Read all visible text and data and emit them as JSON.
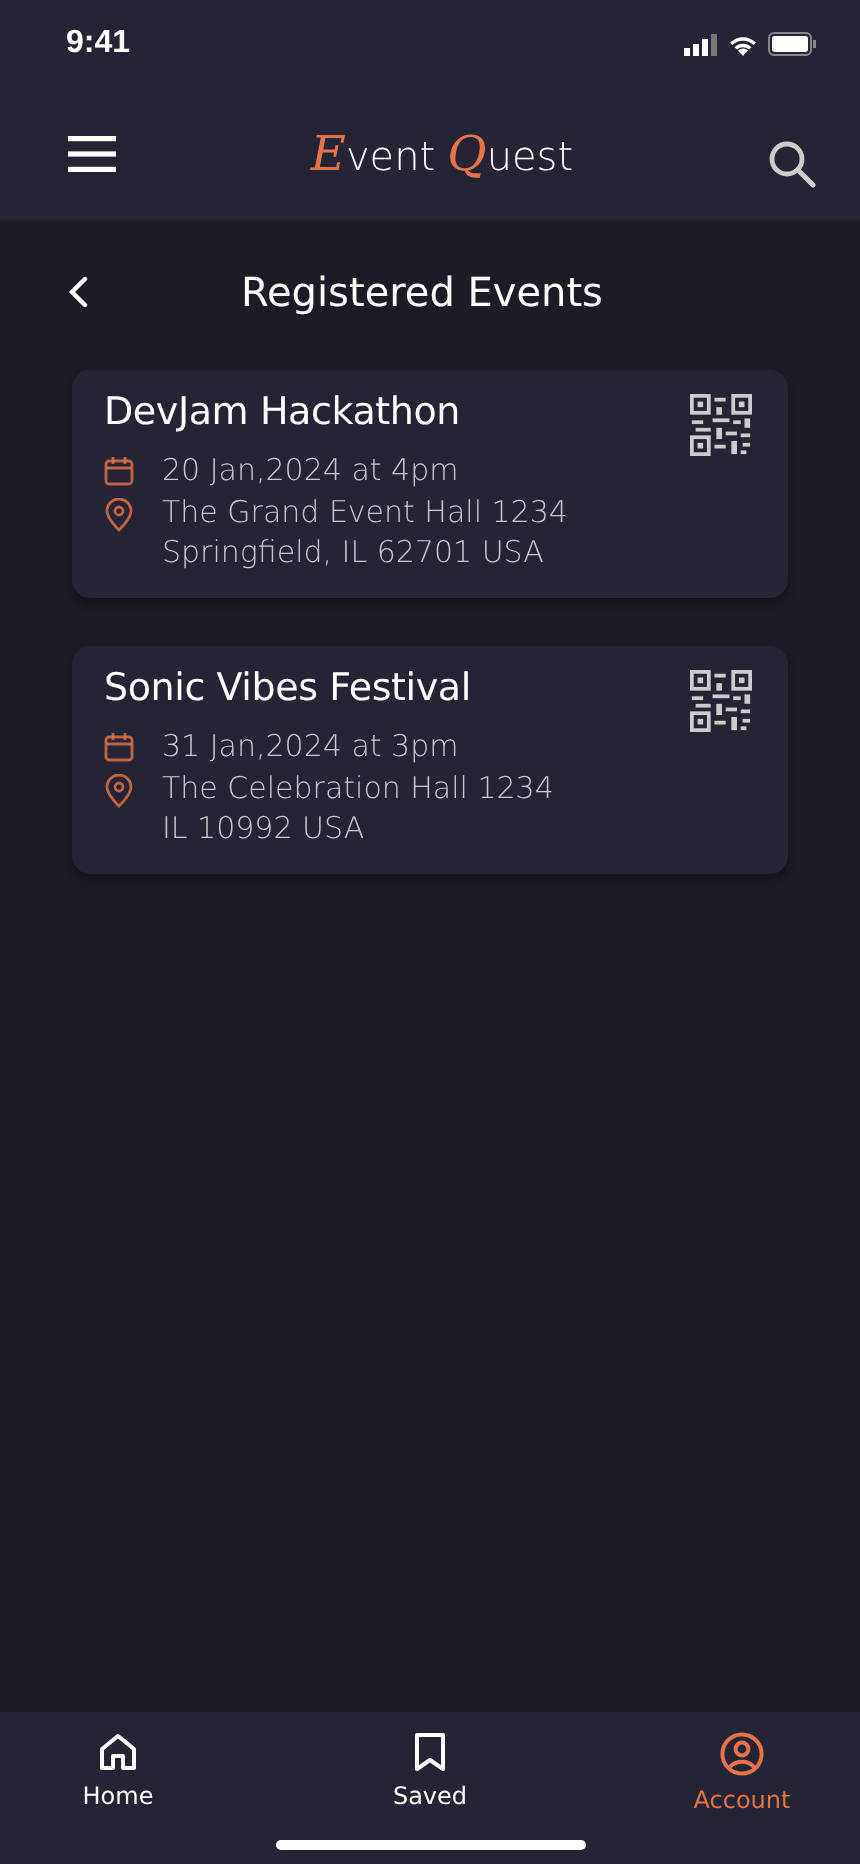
{
  "status_bar": {
    "time": "9:41"
  },
  "header": {
    "logo_words": [
      "Event",
      "Quest"
    ]
  },
  "page": {
    "title": "Registered Events"
  },
  "events": [
    {
      "name": "DevJam Hackathon",
      "date": "20 Jan,2024 at 4pm",
      "address": [
        "The Grand Event Hall 1234",
        "Springfield, IL 62701 USA"
      ]
    },
    {
      "name": "Sonic Vibes Festival",
      "date": "31 Jan,2024 at 3pm",
      "address": [
        "The Celebration Hall 1234",
        "IL 10992 USA"
      ]
    }
  ],
  "tab_bar": [
    {
      "label": "Home",
      "kind": "home",
      "selected": false
    },
    {
      "label": "Saved",
      "kind": "saved",
      "selected": false
    },
    {
      "label": "Account",
      "kind": "account",
      "selected": true
    }
  ]
}
